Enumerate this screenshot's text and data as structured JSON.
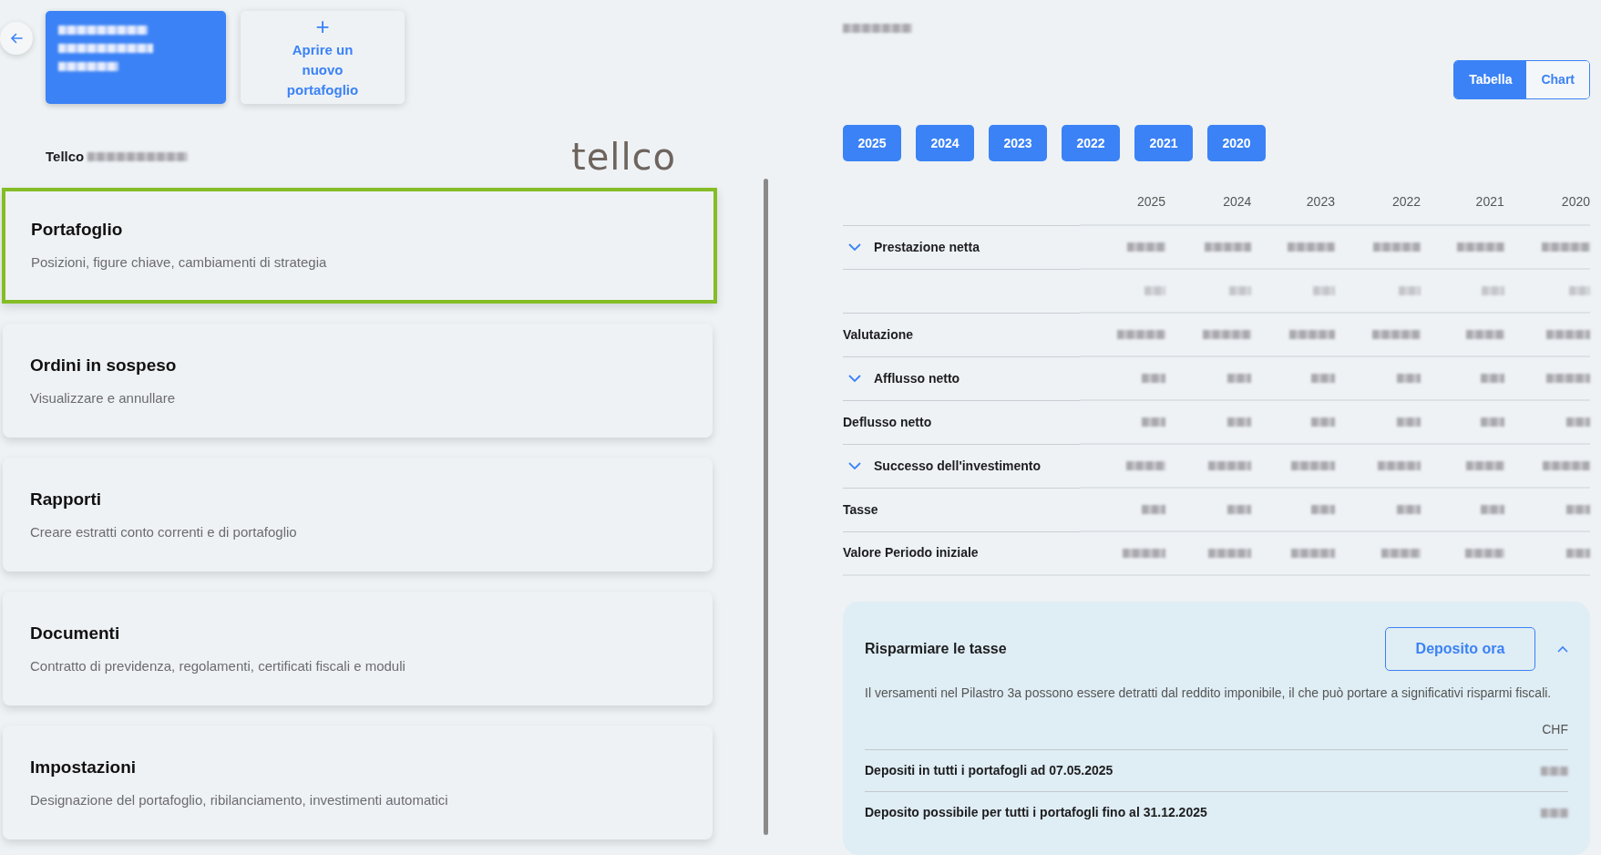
{
  "accounts": [
    {
      "kind": "account",
      "selected": true
    },
    {
      "kind": "new",
      "icon": "+",
      "label": "Aprire un nuovo portafoglio",
      "selected": false
    }
  ],
  "provider": {
    "label": "Tellco",
    "logo": "tellco"
  },
  "menu": [
    {
      "title": "Portafoglio",
      "subtitle": "Posizioni, figure chiave, cambiamenti di strategia",
      "selected": true
    },
    {
      "title": "Ordini in sospeso",
      "subtitle": "Visualizzare e annullare",
      "selected": false
    },
    {
      "title": "Rapporti",
      "subtitle": "Creare estratti conto correnti e di portafoglio",
      "selected": false
    },
    {
      "title": "Documenti",
      "subtitle": "Contratto di previdenza, regolamenti, certificati fiscali e moduli",
      "selected": false
    },
    {
      "title": "Impostazioni",
      "subtitle": "Designazione del portafoglio, ribilanciamento, investimenti automatici",
      "selected": false
    }
  ],
  "view_toggle": [
    {
      "label": "Tabella",
      "selected": true
    },
    {
      "label": "Chart",
      "selected": false
    }
  ],
  "year_buttons": [
    "2025",
    "2024",
    "2023",
    "2022",
    "2021",
    "2020"
  ],
  "table": {
    "columns": [
      "2025",
      "2024",
      "2023",
      "2022",
      "2021",
      "2020"
    ],
    "rows": [
      {
        "label": "Prestazione netta",
        "kind": "group"
      },
      {
        "kind": "sub"
      },
      {
        "label": "Valutazione",
        "kind": "item"
      },
      {
        "label": "Afflusso netto",
        "kind": "group"
      },
      {
        "label": "Deflusso netto",
        "kind": "item"
      },
      {
        "label": "Successo dell'investimento",
        "kind": "group"
      },
      {
        "label": "Tasse",
        "kind": "item"
      },
      {
        "label": "Valore Periodo iniziale",
        "kind": "item"
      }
    ]
  },
  "tax_panel": {
    "title": "Risparmiare le tasse",
    "button": "Deposito ora",
    "expanded": true,
    "text": "Il versamenti nel Pilastro 3a possono essere detratti dal reddito imponibile, il che può portare a significativi risparmi fiscali.",
    "currency": "CHF",
    "rows": [
      {
        "label": "Depositi in tutti i portafogli ad 07.05.2025"
      },
      {
        "label": "Deposito possibile per tutti i portafogli fino al 31.12.2025"
      }
    ]
  }
}
